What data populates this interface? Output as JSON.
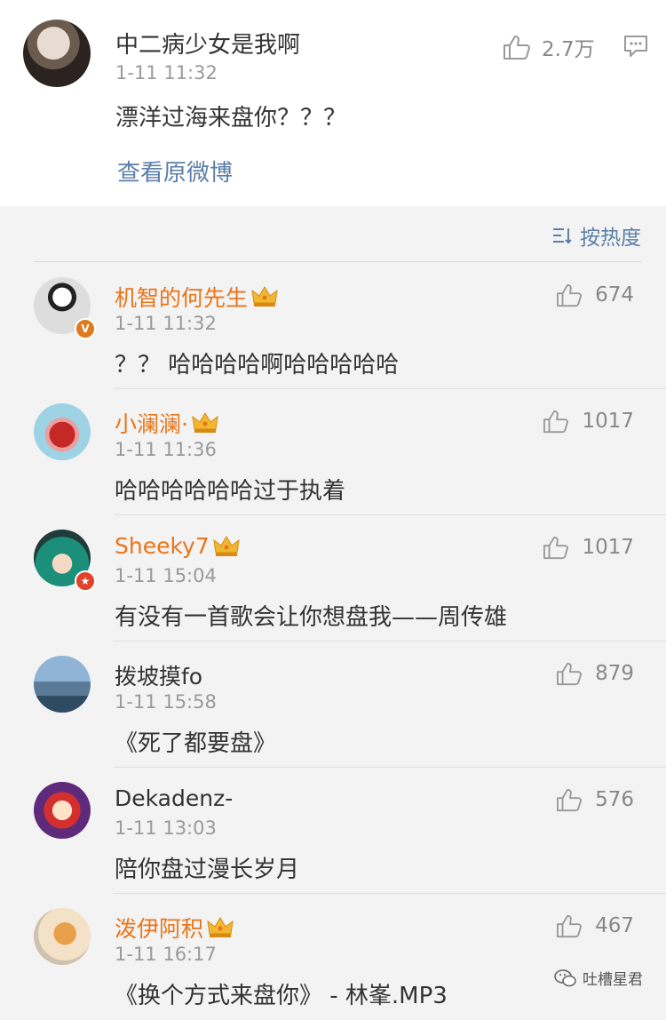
{
  "post": {
    "username": "中二病少女是我啊",
    "time": "1-11 11:32",
    "content": "漂洋过海来盘你？？？",
    "view_original": "查看原微博",
    "likes": "2.7万"
  },
  "sort": {
    "label": "按热度"
  },
  "comments": [
    {
      "username": "机智的何先生",
      "time": "1-11 11:32",
      "text": "？？ 哈哈哈哈啊哈哈哈哈哈",
      "likes": "674"
    },
    {
      "username": "小澜澜·",
      "time": "1-11 11:36",
      "text": "哈哈哈哈哈哈过于执着",
      "likes": "1017"
    },
    {
      "username": "Sheeky7",
      "time": "1-11 15:04",
      "text": "有没有一首歌会让你想盘我——周传雄",
      "likes": "1017"
    },
    {
      "username": "拨坡摸fo",
      "time": "1-11 15:58",
      "text": "《死了都要盘》",
      "likes": "879"
    },
    {
      "username": "Dekadenz-",
      "time": "1-11 13:03",
      "text": "陪你盘过漫长岁月",
      "likes": "576"
    },
    {
      "username": "泼伊阿积",
      "time": "1-11 16:17",
      "text": "《换个方式来盘你》 - 林峯.MP3",
      "likes": "467"
    }
  ],
  "watermark": {
    "label": "吐槽星君"
  },
  "colors": {
    "vip_name": "#e8751a",
    "link": "#5b7fa8",
    "meta": "#9a9a9a"
  }
}
